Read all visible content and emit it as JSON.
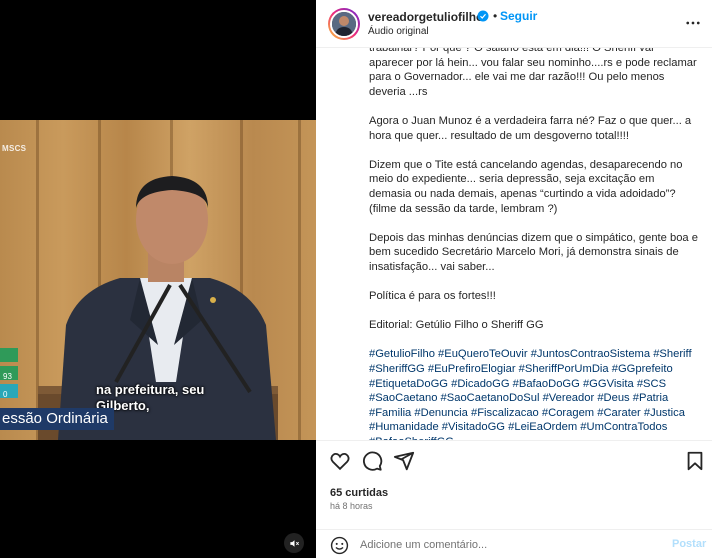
{
  "header": {
    "username": "vereadorgetuliofilho",
    "separator": "•",
    "follow_label": "Seguir",
    "audio_label": "Áudio original",
    "verified_icon": "verified-badge-icon",
    "more_icon": "more-options-icon"
  },
  "video": {
    "channel_label": "MSCS",
    "subtitle_line1": "na prefeitura, seu",
    "subtitle_line2": "Gilberto,",
    "lower_third": "essão Ordinária",
    "side_numbers": [
      "",
      "93",
      "0"
    ],
    "mute_icon": "speaker-muted-icon"
  },
  "caption": {
    "paragraphs": [
      "trabalhar? Por quê ? O salário está em dia!!! O Sheriff vai aparecer por lá hein... vou falar seu nominho....rs e pode reclamar para o Governador... ele vai me dar razão!!! Ou pelo menos deveria ...rs",
      "Agora o Juan Munoz é a verdadeira farra né? Faz o que quer... a hora que quer... resultado de um desgoverno total!!!!",
      "Dizem que o Tite está cancelando agendas, desaparecendo no meio do expediente... seria depressão, seja excitação em demasia ou nada demais, apenas “curtindo a vida adoidado”? (filme da sessão da tarde, lembram ?)",
      "Depois das minhas denúncias dizem que o simpático, gente boa e bem sucedido Secretário Marcelo Mori, já demonstra sinais de insatisfação... vai saber...",
      "Política é para os fortes!!!",
      "Editorial: Getúlio Filho o Sheriff GG"
    ],
    "hashtags": [
      "#GetulioFilho",
      "#EuQueroTeOuvir",
      "#JuntosContraoSistema",
      "#Sheriff",
      "#SheriffGG",
      "#EuPrefiroElogiar",
      "#SheriffPorUmDia",
      "#GGprefeito",
      "#EtiquetaDoGG",
      "#DicadoGG",
      "#BafaoDoGG",
      "#GGVisita",
      "#SCS",
      "#SaoCaetano",
      "#SaoCaetanoDoSul",
      "#Vereador",
      "#Deus",
      "#Patria",
      "#Familia",
      "#Denuncia",
      "#Fiscalizacao",
      "#Coragem",
      "#Carater",
      "#Justica",
      "#Humanidade",
      "#VisitadoGG",
      "#LeiEaOrdem",
      "#UmContraTodos",
      "#BafaoSheriffGG"
    ]
  },
  "actions": {
    "icons": [
      "heart-icon",
      "comment-icon",
      "share-icon",
      "bookmark-icon"
    ],
    "likes_text": "65 curtidas",
    "time_text": "há 8 horas"
  },
  "comment": {
    "placeholder": "Adicione um comentário...",
    "post_label": "Postar",
    "emoji_icon": "emoji-icon"
  },
  "colors": {
    "link": "#00376b",
    "follow": "#0095f6",
    "post_disabled": "#b2dffc",
    "lower_third_bg": "#1f3a67"
  }
}
